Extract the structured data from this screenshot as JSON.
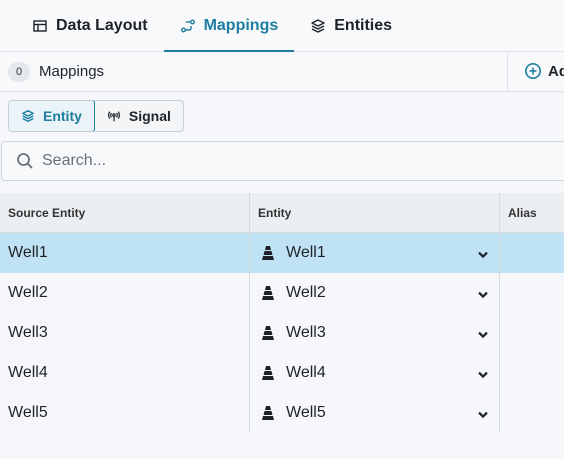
{
  "tabs": [
    {
      "label": "Data Layout",
      "icon": "table-icon",
      "active": false
    },
    {
      "label": "Mappings",
      "icon": "mappings-icon",
      "active": true
    },
    {
      "label": "Entities",
      "icon": "layers-icon",
      "active": false
    }
  ],
  "mappings_bar": {
    "count": "0",
    "label": "Mappings",
    "add_label": "Ad"
  },
  "toggle": {
    "entity_label": "Entity",
    "signal_label": "Signal",
    "selected": "Entity"
  },
  "search": {
    "placeholder": "Search...",
    "value": ""
  },
  "table": {
    "columns": [
      "Source Entity",
      "Entity",
      "Alias"
    ],
    "rows": [
      {
        "source": "Well1",
        "entity": "Well1",
        "alias": "",
        "selected": true
      },
      {
        "source": "Well2",
        "entity": "Well2",
        "alias": "",
        "selected": false
      },
      {
        "source": "Well3",
        "entity": "Well3",
        "alias": "",
        "selected": false
      },
      {
        "source": "Well4",
        "entity": "Well4",
        "alias": "",
        "selected": false
      },
      {
        "source": "Well5",
        "entity": "Well5",
        "alias": "",
        "selected": false
      }
    ]
  },
  "colors": {
    "accent": "#1e7ea0",
    "selected_row": "#bfe3f4"
  }
}
